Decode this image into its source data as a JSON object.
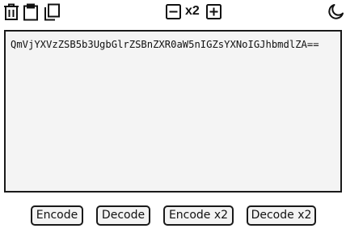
{
  "toolbar": {
    "left_icons": [
      "trash-icon",
      "clipboard-icon",
      "copy-icon"
    ],
    "multiplier_label": "x2",
    "multiplier_icons": [
      "minus-square-icon",
      "plus-square-icon"
    ],
    "theme_icon": "moon-icon"
  },
  "editor": {
    "value": "QmVjYXVzZSB5b3UgbGlrZSBnZXR0aW5nIGZsYXNoIGJhbmdlZA=="
  },
  "actions": {
    "encode_label": "Encode",
    "decode_label": "Decode",
    "encode_x2_label": "Encode x2",
    "decode_x2_label": "Decode x2"
  },
  "colors": {
    "border": "#1a1a1a",
    "editor_background": "#f4f4f4",
    "button_background": "#f3f3f3"
  }
}
